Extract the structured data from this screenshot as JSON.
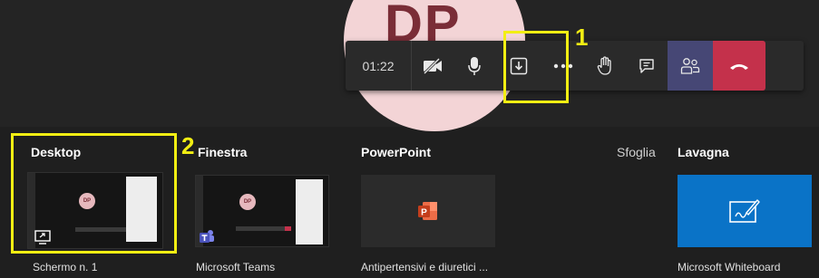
{
  "call": {
    "avatar_initials": "DP",
    "timer": "01:22"
  },
  "toolbar": {
    "items": [
      {
        "name": "camera-off-icon"
      },
      {
        "name": "microphone-icon"
      },
      {
        "name": "share-screen-icon"
      },
      {
        "name": "more-icon"
      },
      {
        "name": "raise-hand-icon"
      },
      {
        "name": "chat-icon"
      },
      {
        "name": "participants-icon"
      },
      {
        "name": "hang-up-icon"
      }
    ],
    "colors": {
      "participants_bg": "#464775",
      "hangup_bg": "#c4314b"
    }
  },
  "annotations": {
    "one": "1",
    "two": "2",
    "color": "#f2ee13"
  },
  "share_tray": {
    "sections": {
      "desktop": "Desktop",
      "window": "Finestra",
      "powerpoint": "PowerPoint",
      "browse": "Sfoglia",
      "whiteboard": "Lavagna"
    },
    "tiles": {
      "screen": "Schermo n. 1",
      "teams": "Microsoft Teams",
      "ppt_file": "Antipertensivi e diuretici ...",
      "whiteboard_app": "Microsoft Whiteboard"
    },
    "mini_avatar": "DP"
  }
}
